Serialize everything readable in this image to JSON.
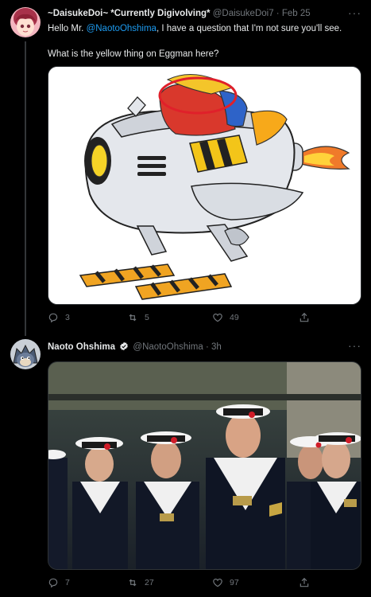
{
  "tweets": [
    {
      "display_name": "~DaisukeDoi~ *Currently Digivolving*",
      "handle": "@DaisukeDoi7",
      "separator": "·",
      "time": "Feb 25",
      "text_before_mention": "Hello Mr. ",
      "mention": "@NaotoOhshima",
      "text_after_mention": ", I have a question that I'm not sure you'll see.",
      "text_line2": "What is the yellow thing on Eggman here?",
      "replies": "3",
      "retweets": "5",
      "likes": "49",
      "more": "···"
    },
    {
      "display_name": "Naoto Ohshima",
      "handle": "@NaotoOhshima",
      "separator": "·",
      "time": "3h",
      "replies": "7",
      "retweets": "27",
      "likes": "97",
      "more": "···"
    }
  ],
  "colors": {
    "background": "#000000",
    "text": "#e7e9ea",
    "muted": "#71767b",
    "link": "#1d9bf0",
    "verified": "#e7e9ea"
  },
  "icons": {
    "reply": "reply-icon",
    "retweet": "retweet-icon",
    "like": "heart-icon",
    "share": "share-icon",
    "verified": "verified-badge-icon"
  }
}
